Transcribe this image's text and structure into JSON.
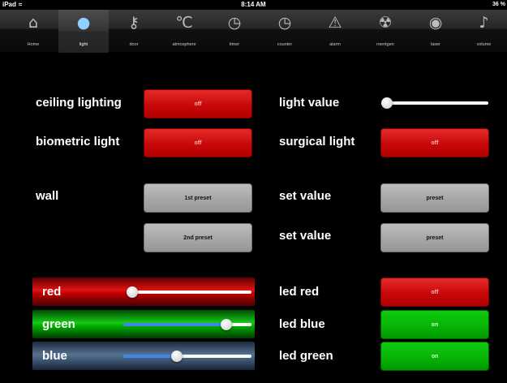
{
  "status": {
    "device": "iPad",
    "time": "8:14 AM",
    "battery": "36 %"
  },
  "tabs": [
    {
      "label": "Home",
      "icon": "home-icon",
      "glyph": "⌂"
    },
    {
      "label": "light",
      "icon": "lightbulb-icon",
      "glyph": "●"
    },
    {
      "label": "door",
      "icon": "key-icon",
      "glyph": "⚷"
    },
    {
      "label": "atmosphere",
      "icon": "thermometer-icon",
      "glyph": "℃"
    },
    {
      "label": "timer",
      "icon": "stopwatch-icon",
      "glyph": "◷"
    },
    {
      "label": "counter",
      "icon": "stopwatch-icon",
      "glyph": "◷"
    },
    {
      "label": "alarm",
      "icon": "warning-icon",
      "glyph": "⚠"
    },
    {
      "label": "roentgen",
      "icon": "radiation-icon",
      "glyph": "☢"
    },
    {
      "label": "laser",
      "icon": "globe-icon",
      "glyph": "◉"
    },
    {
      "label": "volume",
      "icon": "music-note-icon",
      "glyph": "♪"
    }
  ],
  "active_tab": "light",
  "left": {
    "ceiling_lighting": {
      "label": "ceiling lighting",
      "button": "off"
    },
    "biometric_light": {
      "label": "biometric light",
      "button": "off"
    },
    "wall": {
      "label": "wall",
      "preset1": "1st preset",
      "preset2": "2nd preset"
    }
  },
  "right": {
    "light_value": {
      "label": "light value",
      "level": 0.0
    },
    "surgical_light": {
      "label": "surgical light",
      "button": "off"
    },
    "set_value_1": {
      "label": "set value",
      "button": "preset"
    },
    "set_value_2": {
      "label": "set value",
      "button": "preset"
    }
  },
  "rgb": {
    "red": {
      "label": "red",
      "level": 0.0
    },
    "green": {
      "label": "green",
      "level": 0.83
    },
    "blue": {
      "label": "blue",
      "level": 0.41
    }
  },
  "led": {
    "red": {
      "label": "led red",
      "button": "off"
    },
    "blue": {
      "label": "led blue",
      "button": "on"
    },
    "green": {
      "label": "led green",
      "button": "on"
    }
  },
  "colors": {
    "red": "#c80808",
    "green": "#07b307",
    "gray": "#a6a6a6",
    "slider_fill": "#3b86e6"
  }
}
